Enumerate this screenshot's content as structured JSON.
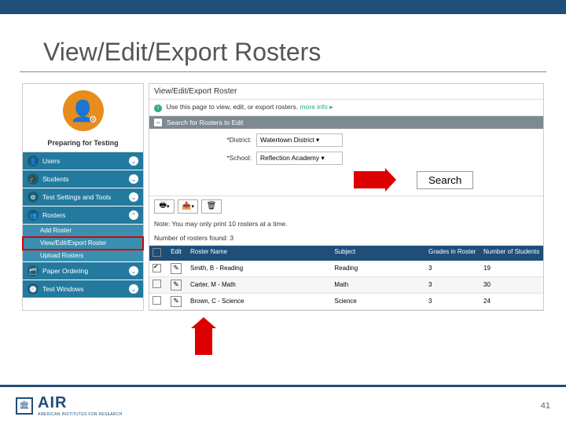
{
  "slide": {
    "title": "View/Edit/Export Rosters",
    "page_number": "41"
  },
  "logo": {
    "name": "AIR",
    "subtitle": "AMERICAN INSTITUTES FOR RESEARCH"
  },
  "sidebar": {
    "heading": "Preparing for Testing",
    "items": [
      {
        "icon": "👤",
        "label": "Users",
        "chev": "⌄"
      },
      {
        "icon": "🎓",
        "label": "Students",
        "chev": "⌄"
      },
      {
        "icon": "⚙",
        "label": "Test Settings and Tools",
        "chev": "⌄"
      },
      {
        "icon": "👥",
        "label": "Rosters",
        "chev": "⌃"
      },
      {
        "icon": "🗂",
        "label": "Paper Ordering",
        "chev": "⌄"
      },
      {
        "icon": "🕘",
        "label": "Test Windows",
        "chev": "⌄"
      }
    ],
    "subitems": [
      {
        "label": "Add Roster"
      },
      {
        "label": "View/Edit/Export Roster"
      },
      {
        "label": "Upload Rosters"
      }
    ]
  },
  "main": {
    "title": "View/Edit/Export Roster",
    "desc": "Use this page to view, edit, or export rosters.",
    "more": "more info ▸",
    "panel_title": "Search for Rosters to Edit",
    "panel_toggle": "−",
    "form": {
      "district_label": "*District:",
      "district_value": "Watertown District ▾",
      "school_label": "*School:",
      "school_value": "Reflection Academy ▾"
    },
    "search_btn": "Search",
    "toolbar": {
      "print": "🖶",
      "export": "📤",
      "delete": "🗑"
    },
    "note": "Note: You may only print 10 rosters at a time.",
    "count_label": "Number of rosters found:",
    "count_value": "3",
    "columns": {
      "edit": "Edit",
      "name": "Roster Name",
      "subject": "Subject",
      "grades": "Grades in Roster",
      "students": "Number of Students"
    },
    "rows": [
      {
        "checked": true,
        "name": "Smith, B - Reading",
        "subject": "Reading",
        "grades": "3",
        "students": "19"
      },
      {
        "checked": false,
        "name": "Carter, M - Math",
        "subject": "Math",
        "grades": "3",
        "students": "30"
      },
      {
        "checked": false,
        "name": "Brown, C - Science",
        "subject": "Science",
        "grades": "3",
        "students": "24"
      }
    ]
  }
}
